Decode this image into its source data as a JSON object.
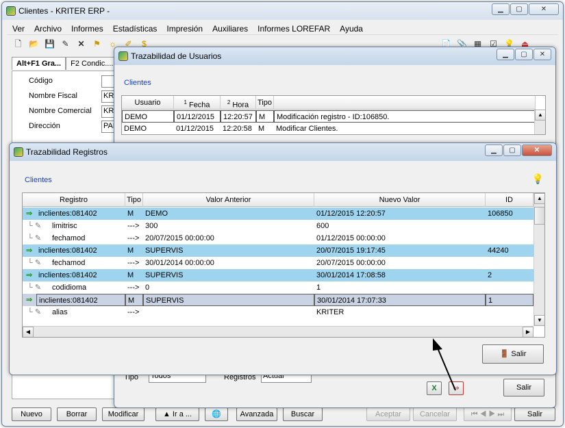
{
  "main": {
    "title": "Clientes - KRITER ERP -",
    "menu": [
      "Ver",
      "Archivo",
      "Informes",
      "Estadísticas",
      "Impresión",
      "Auxiliares",
      "Informes LOREFAR",
      "Ayuda"
    ],
    "tabs": [
      "Alt+F1 Gra...",
      "F2 Condic...."
    ],
    "fields": [
      {
        "label": "Código",
        "value": ""
      },
      {
        "label": "Nombre Fiscal",
        "value": "KRI"
      },
      {
        "label": "Nombre Comercial",
        "value": "KRI"
      },
      {
        "label": "Dirección",
        "value": "PAB"
      }
    ],
    "buttons": {
      "nuevo": "Nuevo",
      "borrar": "Borrar",
      "modificar": "Modificar",
      "ira": "▲ Ir a ...",
      "avanzada": "Avanzada",
      "buscar": "Buscar",
      "aceptar": "Aceptar",
      "cancelar": "Cancelar",
      "salir": "Salir"
    }
  },
  "trazUsuarios": {
    "title": "Trazabilidad de Usuarios",
    "link": "Clientes",
    "headers": {
      "usuario": "Usuario",
      "fecha": "Fecha",
      "hora": "Hora",
      "tipo": "Tipo",
      "fecha_sort": "1",
      "hora_sort": "2"
    },
    "rows": [
      {
        "usuario": "DEMO",
        "fecha": "01/12/2015",
        "hora": "12:20:57",
        "tipo": "M",
        "desc": "Modificación registro - ID:106850."
      },
      {
        "usuario": "DEMO",
        "fecha": "01/12/2015",
        "hora": "12:20:58",
        "tipo": "M",
        "desc": "Modificar Clientes."
      }
    ],
    "filter": {
      "tipo_label": "Tipo",
      "tipo_value": "Todos",
      "registros_label": "Registros",
      "registros_value": "Actual"
    },
    "salir": "Salir"
  },
  "trazRegistros": {
    "title": "Trazabilidad Registros",
    "link": "Clientes",
    "headers": {
      "registro": "Registro",
      "tipo": "Tipo",
      "valor_anterior": "Valor Anterior",
      "nuevo_valor": "Nuevo Valor",
      "id": "ID"
    },
    "rows": [
      {
        "kind": "parent",
        "registro": "inclientes:081402",
        "tipo": "M",
        "anterior": "DEMO",
        "nuevo": "01/12/2015 12:20:57",
        "id": "106850"
      },
      {
        "kind": "child",
        "registro": "limitrisc",
        "tipo": "--->",
        "anterior": "300",
        "nuevo": "600",
        "id": ""
      },
      {
        "kind": "child",
        "registro": "fechamod",
        "tipo": "--->",
        "anterior": "20/07/2015 00:00:00",
        "nuevo": "01/12/2015 00:00:00",
        "id": ""
      },
      {
        "kind": "parent",
        "registro": "inclientes:081402",
        "tipo": "M",
        "anterior": "SUPERVIS",
        "nuevo": "20/07/2015 19:17:45",
        "id": "44240"
      },
      {
        "kind": "child",
        "registro": "fechamod",
        "tipo": "--->",
        "anterior": "30/01/2014 00:00:00",
        "nuevo": "20/07/2015 00:00:00",
        "id": ""
      },
      {
        "kind": "parent",
        "registro": "inclientes:081402",
        "tipo": "M",
        "anterior": "SUPERVIS",
        "nuevo": "30/01/2014 17:08:58",
        "id": "2"
      },
      {
        "kind": "child",
        "registro": "codidioma",
        "tipo": "--->",
        "anterior": "0",
        "nuevo": "1",
        "id": ""
      },
      {
        "kind": "selected",
        "registro": "inclientes:081402",
        "tipo": "M",
        "anterior": "SUPERVIS",
        "nuevo": "30/01/2014 17:07:33",
        "id": "1"
      },
      {
        "kind": "child",
        "registro": "alias",
        "tipo": "--->",
        "anterior": "",
        "nuevo": "KRITER",
        "id": ""
      }
    ],
    "salir": "Salir"
  }
}
